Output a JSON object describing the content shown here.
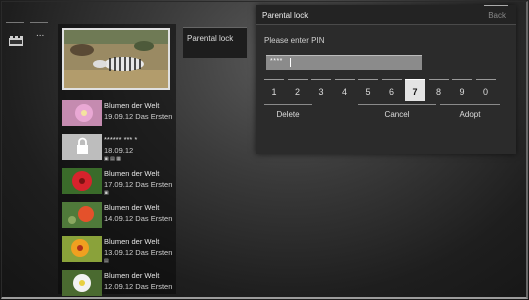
{
  "left_nav": {
    "ellipsis": "..."
  },
  "media_list": {
    "items": [
      {
        "title": "Blumen der Welt",
        "date": "19.09.12 Das Ersten",
        "icons": "",
        "thumb": "pink-flower"
      },
      {
        "title": "****** *** *",
        "date": "18.09.12",
        "icons": "▣ ▤ ▦",
        "thumb": "lock"
      },
      {
        "title": "Blumen der Welt",
        "date": "17.09.12 Das Ersten",
        "icons": "▣",
        "thumb": "red-flower"
      },
      {
        "title": "Blumen der Welt",
        "date": "14.09.12 Das Ersten",
        "icons": "",
        "thumb": "poppy"
      },
      {
        "title": "Blumen der Welt",
        "date": "13.09.12 Das Ersten",
        "icons": "▤",
        "thumb": "orange-flower"
      },
      {
        "title": "Blumen der Welt",
        "date": "12.09.12 Das Ersten",
        "icons": "",
        "thumb": "white-flower"
      }
    ]
  },
  "side_tab": {
    "label": "Parental lock"
  },
  "dialog": {
    "title": "Parental lock",
    "back_label": "Back",
    "prompt": "Please enter PIN",
    "pin_value": "****",
    "digits": [
      "1",
      "2",
      "3",
      "4",
      "5",
      "6",
      "7",
      "8",
      "9",
      "0"
    ],
    "active_digit": "7",
    "delete_label": "Delete",
    "cancel_label": "Cancel",
    "adopt_label": "Adopt"
  }
}
